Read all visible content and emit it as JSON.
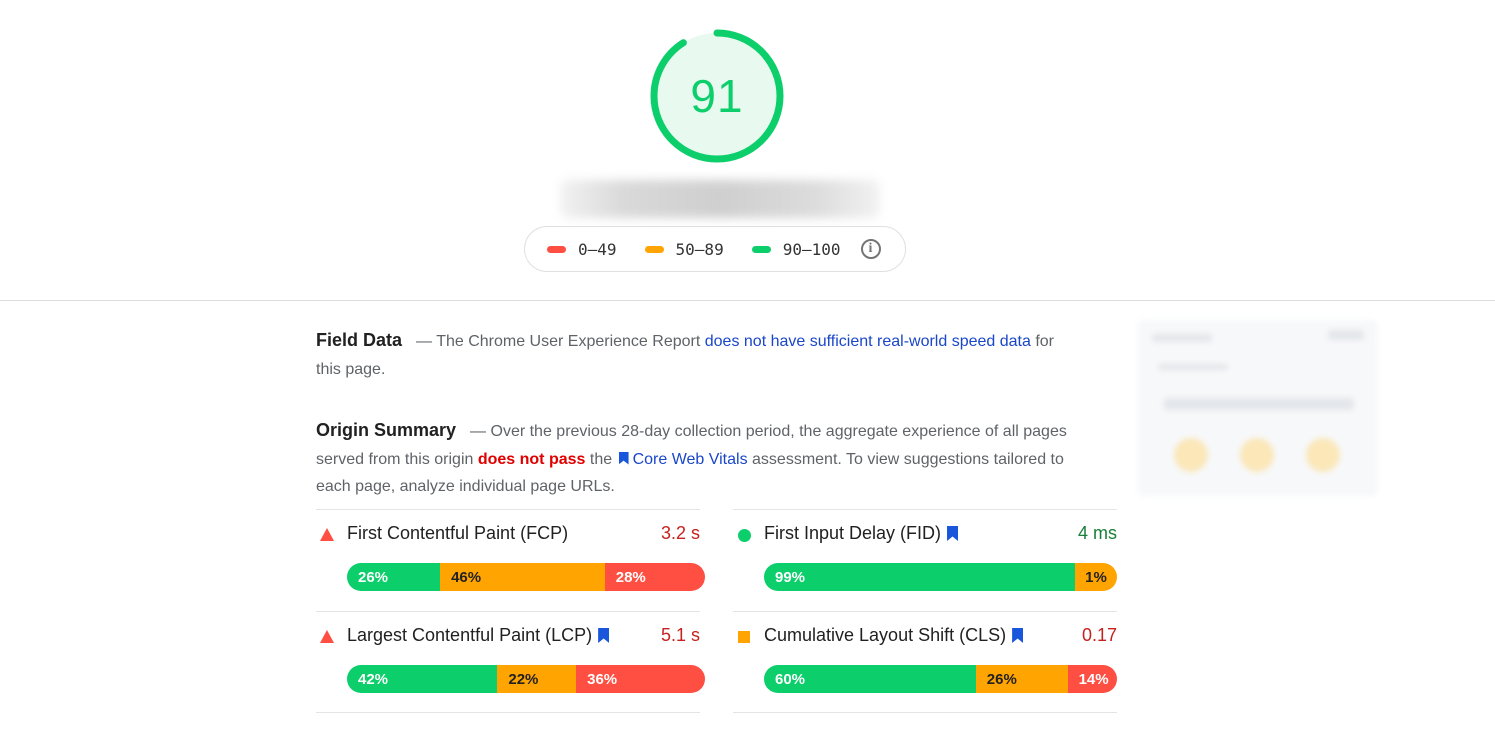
{
  "score": {
    "value": "91",
    "fraction": 0.91,
    "color": "#0cce6b"
  },
  "legend": {
    "items": [
      {
        "label": "0–49",
        "color": "#ff4e42"
      },
      {
        "label": "50–89",
        "color": "#ffa400"
      },
      {
        "label": "90–100",
        "color": "#0cce6b"
      }
    ],
    "info_icon": "info-icon"
  },
  "field_data": {
    "title": "Field Data",
    "text_before": "— The Chrome User Experience Report ",
    "link": "does not have sufficient real-world speed data",
    "text_after": " for this page."
  },
  "origin_summary": {
    "title": "Origin Summary",
    "text_before": "— Over the previous 28-day collection period, the aggregate experience of all pages served from this origin ",
    "fail_text": "does not pass",
    "text_mid": " the ",
    "link": "Core Web Vitals",
    "text_after": " assessment. To view suggestions tailored to each page, analyze individual page URLs."
  },
  "metrics": [
    {
      "name": "First Contentful Paint (FCP)",
      "value": "3.2 s",
      "value_color": "#c5221f",
      "status_icon": "triangle-icon",
      "core_vital": false,
      "dist": [
        {
          "label": "26%",
          "pct": 26
        },
        {
          "label": "46%",
          "pct": 46
        },
        {
          "label": "28%",
          "pct": 28
        }
      ]
    },
    {
      "name": "First Input Delay (FID)",
      "value": "4 ms",
      "value_color": "#188038",
      "status_icon": "circle-icon",
      "core_vital": true,
      "dist": [
        {
          "label": "99%",
          "pct": 99
        },
        {
          "label": "1%",
          "pct": 1
        },
        {
          "label": "",
          "pct": 0
        }
      ]
    },
    {
      "name": "Largest Contentful Paint (LCP)",
      "value": "5.1 s",
      "value_color": "#c5221f",
      "status_icon": "triangle-icon",
      "core_vital": true,
      "dist": [
        {
          "label": "42%",
          "pct": 42
        },
        {
          "label": "22%",
          "pct": 22
        },
        {
          "label": "36%",
          "pct": 36
        }
      ]
    },
    {
      "name": "Cumulative Layout Shift (CLS)",
      "value": "0.17",
      "value_color": "#c5221f",
      "status_icon": "square-icon",
      "core_vital": true,
      "dist": [
        {
          "label": "60%",
          "pct": 60
        },
        {
          "label": "26%",
          "pct": 26
        },
        {
          "label": "14%",
          "pct": 14
        }
      ]
    }
  ]
}
